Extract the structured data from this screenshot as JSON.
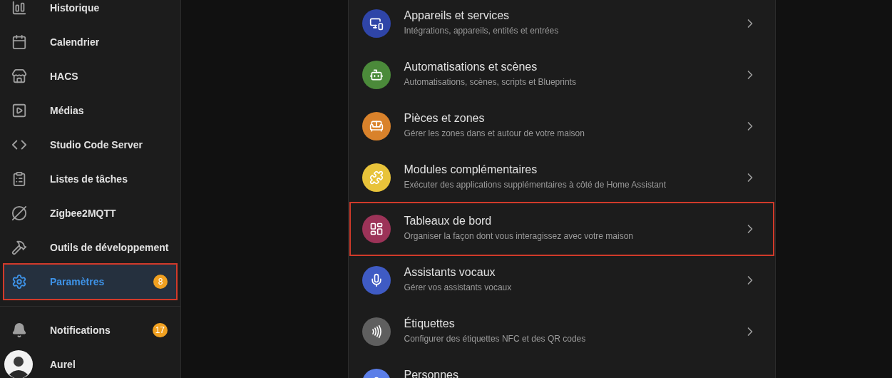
{
  "sidebar": {
    "items": [
      {
        "label": "Historique",
        "selected": false,
        "highlighted": false
      },
      {
        "label": "Calendrier",
        "selected": false,
        "highlighted": false
      },
      {
        "label": "HACS",
        "selected": false,
        "highlighted": false
      },
      {
        "label": "Médias",
        "selected": false,
        "highlighted": false
      },
      {
        "label": "Studio Code Server",
        "selected": false,
        "highlighted": false
      },
      {
        "label": "Listes de tâches",
        "selected": false,
        "highlighted": false
      },
      {
        "label": "Zigbee2MQTT",
        "selected": false,
        "highlighted": false
      },
      {
        "label": "Outils de développement",
        "selected": false,
        "highlighted": false
      },
      {
        "label": "Paramètres",
        "selected": true,
        "highlighted": true,
        "badge": "8"
      }
    ],
    "notifications": {
      "label": "Notifications",
      "badge": "17"
    },
    "user": {
      "name": "Aurel"
    }
  },
  "settings": {
    "rows": [
      {
        "title": "Appareils et services",
        "subtitle": "Intégrations, appareils, entités et entrées",
        "color": "#2f45a8",
        "highlighted": false
      },
      {
        "title": "Automatisations et scènes",
        "subtitle": "Automatisations, scènes, scripts et Blueprints",
        "color": "#4b8a3a",
        "highlighted": false
      },
      {
        "title": "Pièces et zones",
        "subtitle": "Gérer les zones dans et autour de votre maison",
        "color": "#d9822b",
        "highlighted": false
      },
      {
        "title": "Modules complémentaires",
        "subtitle": "Exécuter des applications supplémentaires à côté de Home Assistant",
        "color": "#e8c33a",
        "highlighted": false
      },
      {
        "title": "Tableaux de bord",
        "subtitle": "Organiser la façon dont vous interagissez avec votre maison",
        "color": "#9c3358",
        "highlighted": true
      },
      {
        "title": "Assistants vocaux",
        "subtitle": "Gérer vos assistants vocaux",
        "color": "#3f5bc4",
        "highlighted": false
      },
      {
        "title": "Étiquettes",
        "subtitle": "Configurer des étiquettes NFC et des QR codes",
        "color": "#5f5f5f",
        "highlighted": false
      },
      {
        "title": "Personnes",
        "color": "#5b7ee8",
        "highlighted": false
      }
    ]
  }
}
